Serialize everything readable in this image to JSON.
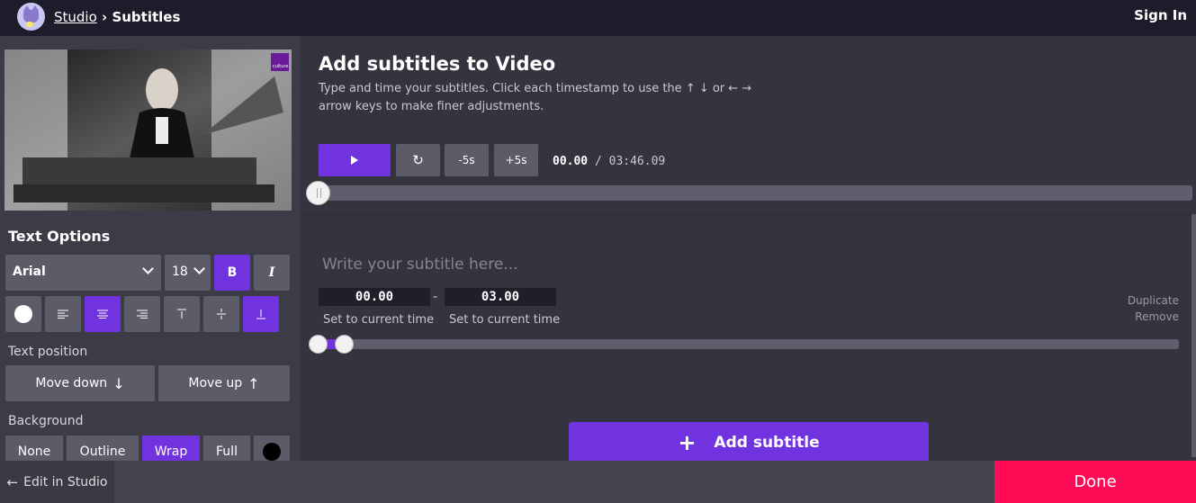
{
  "header": {
    "breadcrumb_studio": "Studio",
    "breadcrumb_sep": "›",
    "breadcrumb_current": "Subtitles",
    "sign_in": "Sign In"
  },
  "video": {
    "badge_text": "culture"
  },
  "text_options": {
    "title": "Text Options",
    "font": "Arial",
    "size": "18",
    "bold": "B",
    "italic": "I",
    "position_label": "Text position",
    "move_down": "Move down",
    "move_up": "Move up",
    "background_label": "Background",
    "bg_none": "None",
    "bg_outline": "Outline",
    "bg_wrap": "Wrap",
    "bg_full": "Full"
  },
  "main": {
    "title": "Add subtitles to Video",
    "description": "Type and time your subtitles. Click each timestamp to use the ↑ ↓ or ← → arrow keys to make finer adjustments.",
    "minus5": "-5s",
    "plus5": "+5s",
    "current_time": "00.00",
    "time_sep": "/",
    "total_time": "03:46.09",
    "playback_progress": 0
  },
  "subtitle": {
    "placeholder": "Write your subtitle here...",
    "start": "00.00",
    "dash": "-",
    "end": "03.00",
    "set_current_start": "Set to current time",
    "set_current_end": "Set to current time",
    "duplicate": "Duplicate",
    "remove": "Remove"
  },
  "add_subtitle": "Add subtitle",
  "footer": {
    "edit_in_studio": "Edit in Studio",
    "done": "Done"
  },
  "colors": {
    "accent": "#7133e0",
    "done": "#ff0a54",
    "topbar": "#1c1c2a"
  }
}
